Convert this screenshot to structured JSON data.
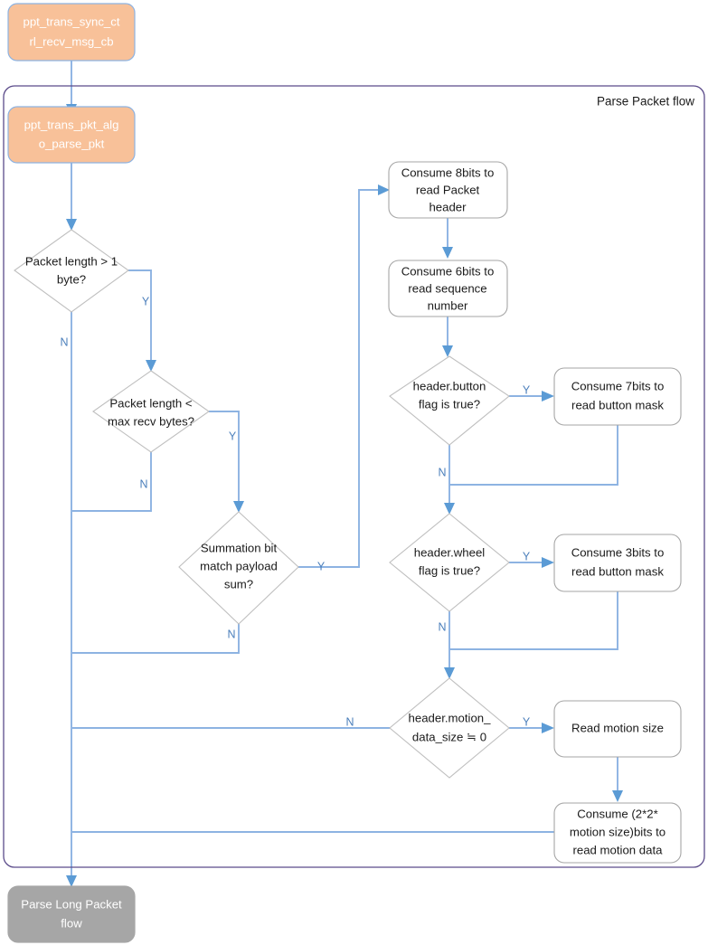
{
  "diagram": {
    "title": "Parse Packet flow",
    "group_label": "Parse Packet flow",
    "colors": {
      "terminator_fill": "#f8c199",
      "terminator_stroke": "#8db3e2",
      "process_fill": "#ffffff",
      "process_stroke": "#a6a6a6",
      "decision_stroke": "#bfbfbf",
      "connector": "#8db3e2",
      "arrowhead": "#5b9bd5",
      "group_border": "#5b4b8a",
      "gray_fill": "#a6a6a6",
      "label_text": "#4a7ebb"
    },
    "nodes": {
      "entry": {
        "id": "entry",
        "type": "terminator",
        "lines": [
          "ppt_trans_sync_ct",
          "rl_recv_msg_cb"
        ]
      },
      "parse_pkt": {
        "id": "parse_pkt",
        "type": "terminator",
        "lines": [
          "ppt_trans_pkt_alg",
          "o_parse_pkt"
        ]
      },
      "d_len_gt1": {
        "id": "d_len_gt1",
        "type": "decision",
        "lines": [
          "Packet length > 1",
          "byte?"
        ]
      },
      "d_len_lt_max": {
        "id": "d_len_lt_max",
        "type": "decision",
        "lines": [
          "Packet length <",
          "max recv bytes?"
        ]
      },
      "d_sum_match": {
        "id": "d_sum_match",
        "type": "decision",
        "lines": [
          "Summation bit",
          "match payload",
          "sum?"
        ]
      },
      "p_header": {
        "id": "p_header",
        "type": "process",
        "lines": [
          "Consume 8bits to",
          "read Packet",
          "header"
        ]
      },
      "p_sequence": {
        "id": "p_sequence",
        "type": "process",
        "lines": [
          "Consume 6bits to",
          "read sequence",
          "number"
        ]
      },
      "d_button_flag": {
        "id": "d_button_flag",
        "type": "decision",
        "lines": [
          "header.button",
          "flag is true?"
        ]
      },
      "p_button_mask": {
        "id": "p_button_mask",
        "type": "process",
        "lines": [
          "Consume 7bits to",
          "read button mask"
        ]
      },
      "d_wheel_flag": {
        "id": "d_wheel_flag",
        "type": "decision",
        "lines": [
          "header.wheel",
          "flag is true?"
        ]
      },
      "p_wheel_mask": {
        "id": "p_wheel_mask",
        "type": "process",
        "lines": [
          "Consume 3bits to",
          "read button mask"
        ]
      },
      "d_motion_size": {
        "id": "d_motion_size",
        "type": "decision",
        "lines": [
          "header.motion_",
          "data_size ≒ 0"
        ]
      },
      "p_read_motion_size": {
        "id": "p_read_motion_size",
        "type": "process",
        "lines": [
          "Read motion size"
        ]
      },
      "p_motion_data": {
        "id": "p_motion_data",
        "type": "process",
        "lines": [
          "Consume (2*2*",
          "motion size)bits to",
          "read motion data"
        ]
      },
      "exit_long": {
        "id": "exit_long",
        "type": "terminator-gray",
        "lines": [
          "Parse Long Packet",
          "flow"
        ]
      }
    },
    "edge_labels": {
      "len_gt1_yes": "Y",
      "len_gt1_no": "N",
      "len_lt_max_yes": "Y",
      "len_lt_max_no": "N",
      "sum_match_yes": "Y",
      "sum_match_no": "N",
      "button_yes": "Y",
      "button_no": "N",
      "wheel_yes": "Y",
      "wheel_no": "N",
      "motion_yes": "Y",
      "motion_no": "N"
    }
  }
}
